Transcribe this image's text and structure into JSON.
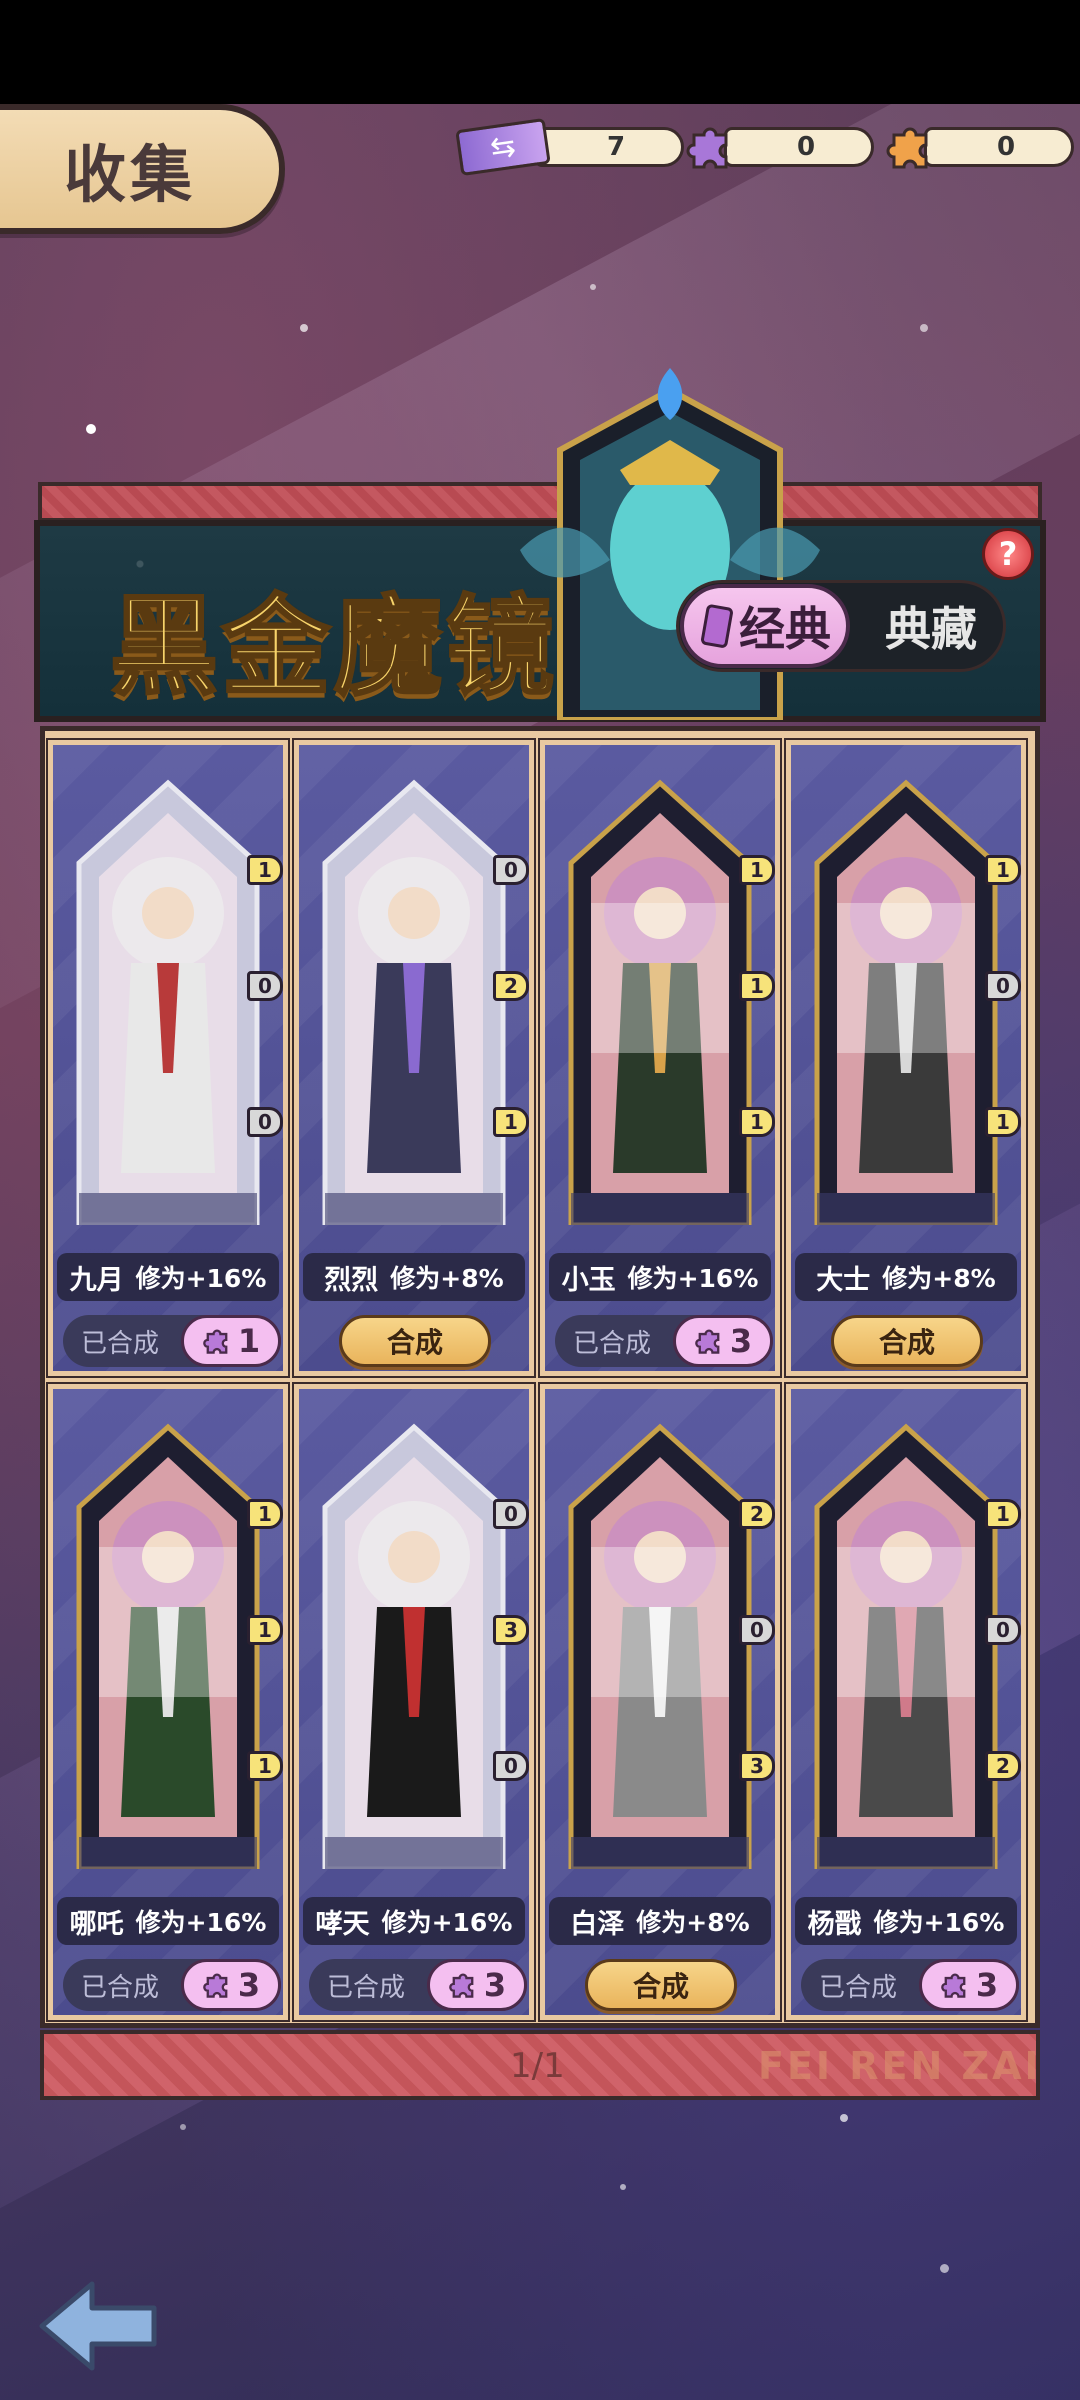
{
  "header": {
    "title": "收集",
    "currencies": [
      {
        "name": "ticket",
        "value": "7"
      },
      {
        "name": "purple-piece",
        "value": "0"
      },
      {
        "name": "orange-piece",
        "value": "0"
      }
    ]
  },
  "banner": {
    "title": "黑金魔镜",
    "tab_active": "经典",
    "tab_inactive": "典藏",
    "help": "?"
  },
  "cards": [
    {
      "name": "九月",
      "bonus": "修为+16%",
      "status": "done",
      "done_label": "已合成",
      "count": "1",
      "badges": [
        {
          "v": "1",
          "c": "y"
        },
        {
          "v": "0",
          "c": "g"
        },
        {
          "v": "0",
          "c": "g"
        }
      ],
      "faded": true
    },
    {
      "name": "烈烈",
      "bonus": "修为+8%",
      "status": "synth",
      "synth_label": "合成",
      "badges": [
        {
          "v": "0",
          "c": "g"
        },
        {
          "v": "2",
          "c": "y"
        },
        {
          "v": "1",
          "c": "y"
        }
      ],
      "faded": true
    },
    {
      "name": "小玉",
      "bonus": "修为+16%",
      "status": "done",
      "done_label": "已合成",
      "count": "3",
      "badges": [
        {
          "v": "1",
          "c": "y"
        },
        {
          "v": "1",
          "c": "y"
        },
        {
          "v": "1",
          "c": "y"
        }
      ],
      "faded": false
    },
    {
      "name": "大士",
      "bonus": "修为+8%",
      "status": "synth",
      "synth_label": "合成",
      "badges": [
        {
          "v": "1",
          "c": "y"
        },
        {
          "v": "0",
          "c": "g"
        },
        {
          "v": "1",
          "c": "y"
        }
      ],
      "faded": false
    },
    {
      "name": "哪吒",
      "bonus": "修为+16%",
      "status": "done",
      "done_label": "已合成",
      "count": "3",
      "badges": [
        {
          "v": "1",
          "c": "y"
        },
        {
          "v": "1",
          "c": "y"
        },
        {
          "v": "1",
          "c": "y"
        }
      ],
      "faded": false
    },
    {
      "name": "哮天",
      "bonus": "修为+16%",
      "status": "done",
      "done_label": "已合成",
      "count": "3",
      "badges": [
        {
          "v": "0",
          "c": "g"
        },
        {
          "v": "3",
          "c": "y"
        },
        {
          "v": "0",
          "c": "g"
        }
      ],
      "faded": true
    },
    {
      "name": "白泽",
      "bonus": "修为+8%",
      "status": "synth",
      "synth_label": "合成",
      "badges": [
        {
          "v": "2",
          "c": "y"
        },
        {
          "v": "0",
          "c": "g"
        },
        {
          "v": "3",
          "c": "y"
        }
      ],
      "faded": false
    },
    {
      "name": "杨戬",
      "bonus": "修为+16%",
      "status": "done",
      "done_label": "已合成",
      "count": "3",
      "badges": [
        {
          "v": "1",
          "c": "y"
        },
        {
          "v": "0",
          "c": "g"
        },
        {
          "v": "2",
          "c": "y"
        }
      ],
      "faded": false
    }
  ],
  "footer": {
    "pager": "1/1",
    "watermark": "FEI REN ZAI"
  },
  "colors": {
    "gold": "#f7d36a",
    "pink": "#f4bff0",
    "synth": "#e9b45c"
  }
}
